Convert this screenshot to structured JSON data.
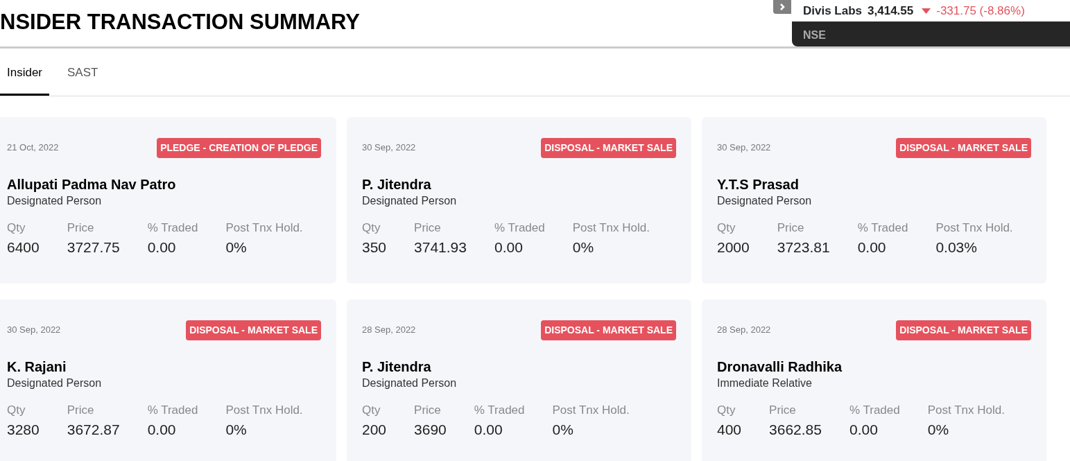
{
  "page_title": "NSIDER TRANSACTION SUMMARY",
  "stock": {
    "name": "Divis Labs",
    "price": "3,414.55",
    "down": true,
    "change": "-331.75 (-8.86%)",
    "exchange": "NSE"
  },
  "tabs": [
    {
      "label": "Insider",
      "selected": true
    },
    {
      "label": "SAST",
      "selected": false
    }
  ],
  "cards": [
    {
      "date": "21 Oct, 2022",
      "type": "PLEDGE - CREATION OF PLEDGE",
      "name": "Allupati Padma Nav Patro",
      "role": "Designated Person",
      "stats": [
        {
          "label": "Qty",
          "value": "6400"
        },
        {
          "label": "Price",
          "value": "3727.75"
        },
        {
          "label": "% Traded",
          "value": "0.00"
        },
        {
          "label": "Post Tnx Hold.",
          "value": "0%"
        }
      ]
    },
    {
      "date": "30 Sep, 2022",
      "type": "DISPOSAL - MARKET SALE",
      "name": "P. Jitendra",
      "role": "Designated Person",
      "stats": [
        {
          "label": "Qty",
          "value": "350"
        },
        {
          "label": "Price",
          "value": "3741.93"
        },
        {
          "label": "% Traded",
          "value": "0.00"
        },
        {
          "label": "Post Tnx Hold.",
          "value": "0%"
        }
      ]
    },
    {
      "date": "30 Sep, 2022",
      "type": "DISPOSAL - MARKET SALE",
      "name": "Y.T.S Prasad",
      "role": "Designated Person",
      "stats": [
        {
          "label": "Qty",
          "value": "2000"
        },
        {
          "label": "Price",
          "value": "3723.81"
        },
        {
          "label": "% Traded",
          "value": "0.00"
        },
        {
          "label": "Post Tnx Hold.",
          "value": "0.03%"
        }
      ]
    },
    {
      "date": "30 Sep, 2022",
      "type": "DISPOSAL - MARKET SALE",
      "name": "K. Rajani",
      "role": "Designated Person",
      "stats": [
        {
          "label": "Qty",
          "value": "3280"
        },
        {
          "label": "Price",
          "value": "3672.87"
        },
        {
          "label": "% Traded",
          "value": "0.00"
        },
        {
          "label": "Post Tnx Hold.",
          "value": "0%"
        }
      ]
    },
    {
      "date": "28 Sep, 2022",
      "type": "DISPOSAL - MARKET SALE",
      "name": "P. Jitendra",
      "role": "Designated Person",
      "stats": [
        {
          "label": "Qty",
          "value": "200"
        },
        {
          "label": "Price",
          "value": "3690"
        },
        {
          "label": "% Traded",
          "value": "0.00"
        },
        {
          "label": "Post Tnx Hold.",
          "value": "0%"
        }
      ]
    },
    {
      "date": "28 Sep, 2022",
      "type": "DISPOSAL - MARKET SALE",
      "name": "Dronavalli Radhika",
      "role": "Immediate Relative",
      "stats": [
        {
          "label": "Qty",
          "value": "400"
        },
        {
          "label": "Price",
          "value": "3662.85"
        },
        {
          "label": "% Traded",
          "value": "0.00"
        },
        {
          "label": "Post Tnx Hold.",
          "value": "0%"
        }
      ]
    }
  ]
}
